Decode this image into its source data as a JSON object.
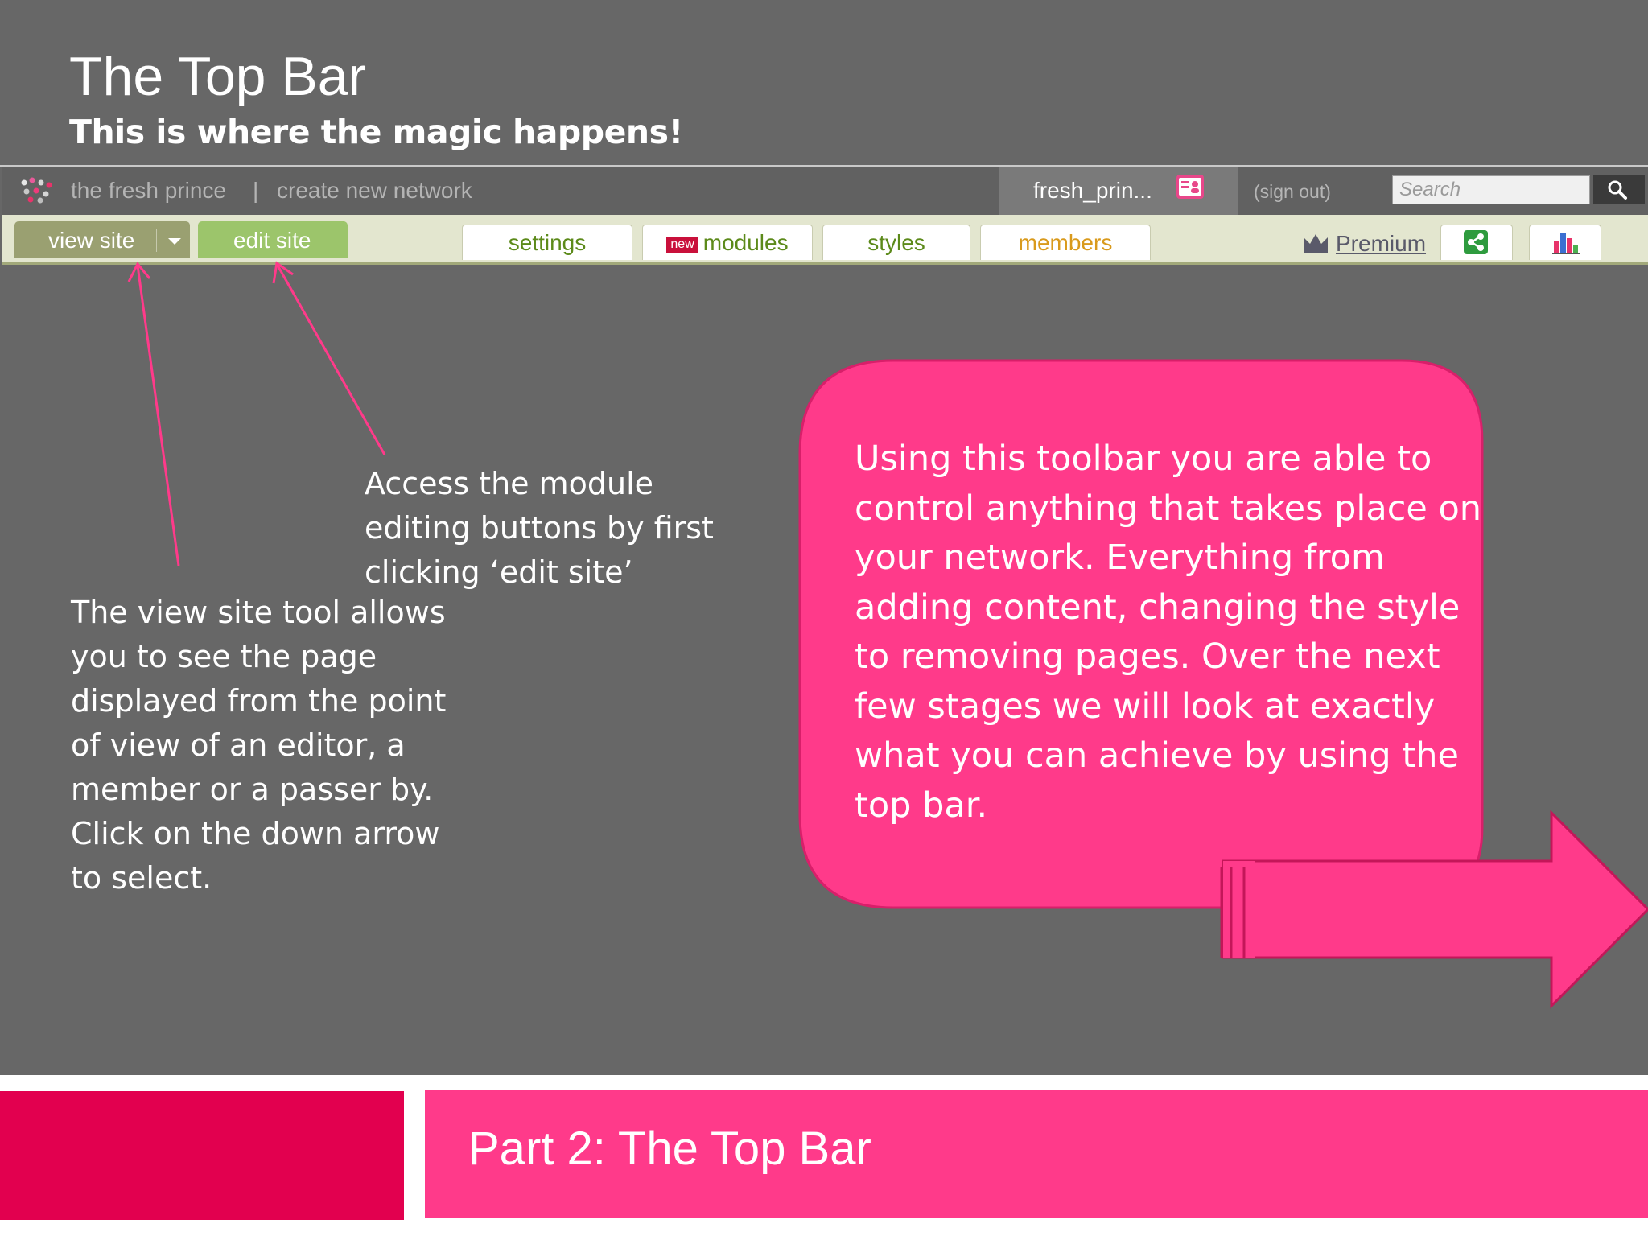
{
  "slide": {
    "title": "The Top Bar",
    "subtitle": "This is where the magic happens!"
  },
  "toolbar": {
    "network_name": "the fresh prince",
    "separator": "|",
    "create_network": "create new network",
    "username": "fresh_prin...",
    "sign_out": "(sign out)",
    "search_placeholder": "Search",
    "view_site": "view site",
    "edit_site": "edit site",
    "tabs": {
      "settings": "settings",
      "modules_badge": "new",
      "modules": "modules",
      "styles": "styles",
      "members": "members"
    },
    "premium": "Premium",
    "icons": [
      "logo-icon",
      "profile-card-icon",
      "search-icon",
      "chevron-down-icon",
      "crown-icon",
      "share-icon",
      "bar-chart-icon"
    ]
  },
  "annotations": {
    "edit_site_note": "Access the module editing buttons by first clicking ‘edit site’",
    "view_site_note": "The view site tool allows you to see the page displayed from the point of view of an editor, a member or a passer by. Click on the down arrow to select.",
    "bubble_text": "Using this toolbar you are able to control anything that takes place on your network. Everything from adding content, changing the style to removing pages. Over the next few stages we will look at exactly what you can achieve by using the top bar."
  },
  "footer": {
    "title": "Part 2: The Top Bar"
  },
  "colors": {
    "background": "#676767",
    "accent_pink": "#ff3a8a",
    "footer_crimson": "#e2004f",
    "edit_site_green": "#9cc56b",
    "view_site_olive": "#9aa071",
    "members_orange": "#d99a1c"
  }
}
